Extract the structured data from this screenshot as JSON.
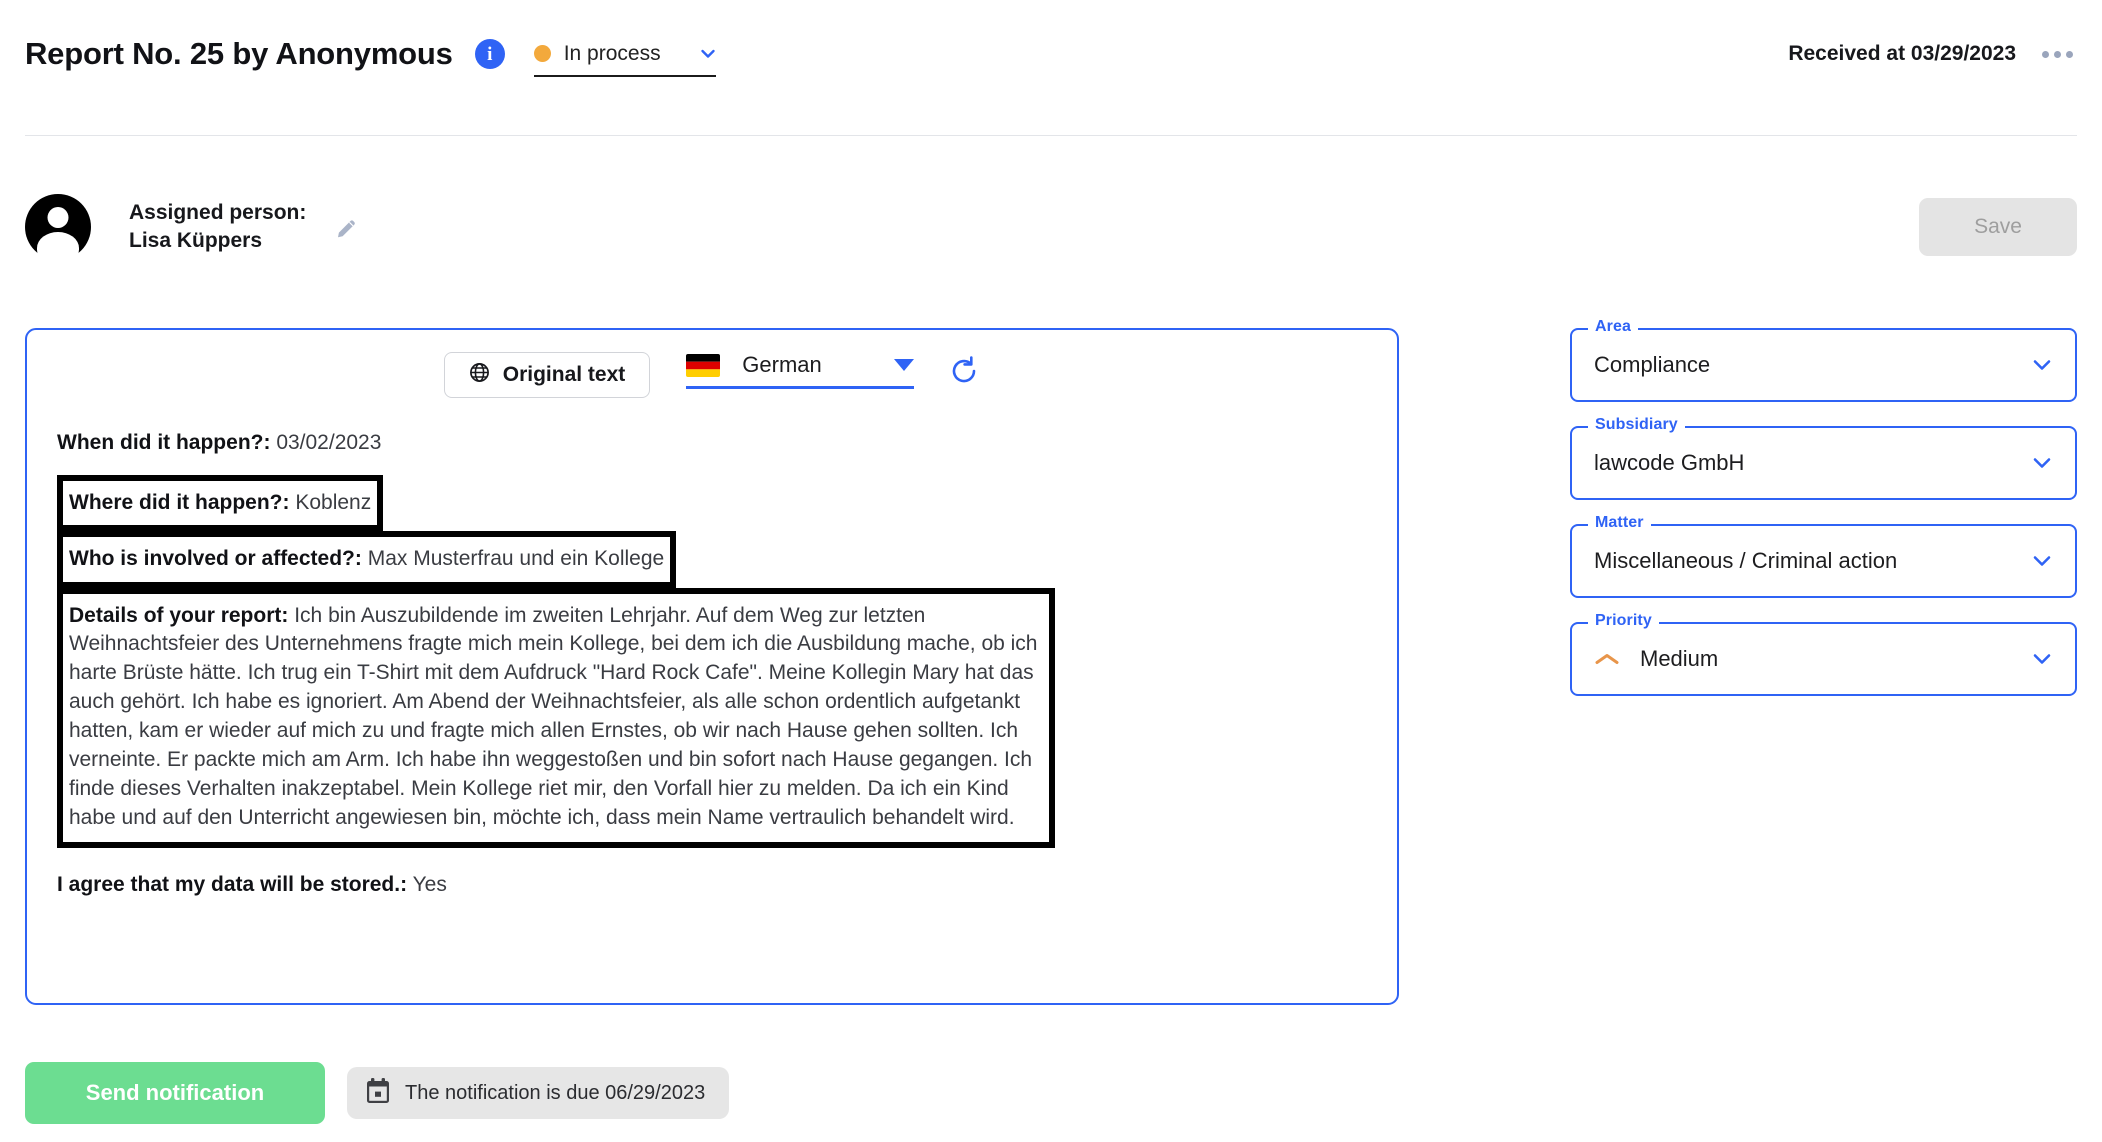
{
  "header": {
    "title": "Report No. 25 by Anonymous",
    "info_icon": "info-icon",
    "status": {
      "label": "In process",
      "dot_color": "#f3a93c",
      "chevron_icon": "chevron-down-icon"
    },
    "received_at": "Received at 03/29/2023",
    "more_icon": "more-options-icon"
  },
  "assignee": {
    "label": "Assigned person:",
    "name": "Lisa Küppers",
    "edit_icon": "pencil-icon",
    "avatar_icon": "user-avatar-icon"
  },
  "toolbar": {
    "save_label": "Save",
    "save_disabled": true
  },
  "card": {
    "original_text_button": "Original text",
    "globe_icon": "globe-icon",
    "language": {
      "value": "German",
      "flag_icon": "flag-germany-icon",
      "caret_icon": "caret-down-icon"
    },
    "refresh_icon": "refresh-icon",
    "fields": [
      {
        "question": "When did it happen?:",
        "answer": "03/02/2023",
        "highlighted": false
      },
      {
        "question": "Where did it happen?:",
        "answer": "Koblenz",
        "highlighted": true
      },
      {
        "question": "Who is involved or affected?:",
        "answer": "Max Musterfrau und ein Kollege",
        "highlighted": true
      },
      {
        "question": "Details of your report:",
        "answer": "Ich bin Auszubildende im zweiten Lehrjahr. Auf dem Weg zur letzten Weihnachtsfeier des Unternehmens fragte mich mein Kollege, bei dem ich die Ausbildung mache, ob ich harte Brüste hätte. Ich trug ein T-Shirt mit dem Aufdruck \"Hard Rock Cafe\". Meine Kollegin Mary hat das auch gehört. Ich habe es ignoriert. Am Abend der Weihnachtsfeier, als alle schon ordentlich aufgetankt hatten, kam er wieder auf mich zu und fragte mich allen Ernstes, ob wir nach Hause gehen sollten. Ich verneinte. Er packte mich am Arm. Ich habe ihn weggestoßen und bin sofort nach Hause gegangen. Ich finde dieses Verhalten inakzeptabel. Mein Kollege riet mir, den Vorfall hier zu melden. Da ich ein Kind habe und auf den Unterricht angewiesen bin, möchte ich, dass mein Name vertraulich behandelt wird.",
        "highlighted": true
      },
      {
        "question": "I agree that my data will be stored.:",
        "answer": "Yes",
        "highlighted": false
      }
    ]
  },
  "actions": {
    "send_notification": "Send notification",
    "due_text": "The notification is due 06/29/2023",
    "calendar_icon": "calendar-icon"
  },
  "side_panel": {
    "fields": [
      {
        "legend": "Area",
        "value": "Compliance",
        "caret_icon": "chevron-down-icon"
      },
      {
        "legend": "Subsidiary",
        "value": "lawcode GmbH",
        "caret_icon": "chevron-down-icon"
      },
      {
        "legend": "Matter",
        "value": "Miscellaneous / Criminal action",
        "caret_icon": "chevron-down-icon"
      },
      {
        "legend": "Priority",
        "value": "Medium",
        "caret_icon": "chevron-down-icon",
        "priority_icon": "chevron-up-orange-icon"
      }
    ]
  },
  "colors": {
    "accent_blue": "#2f63f5",
    "status_orange": "#f3a93c",
    "send_green": "#6cdd91",
    "priority_orange": "#e8954a",
    "disabled_gray": "#e4e4e4"
  }
}
